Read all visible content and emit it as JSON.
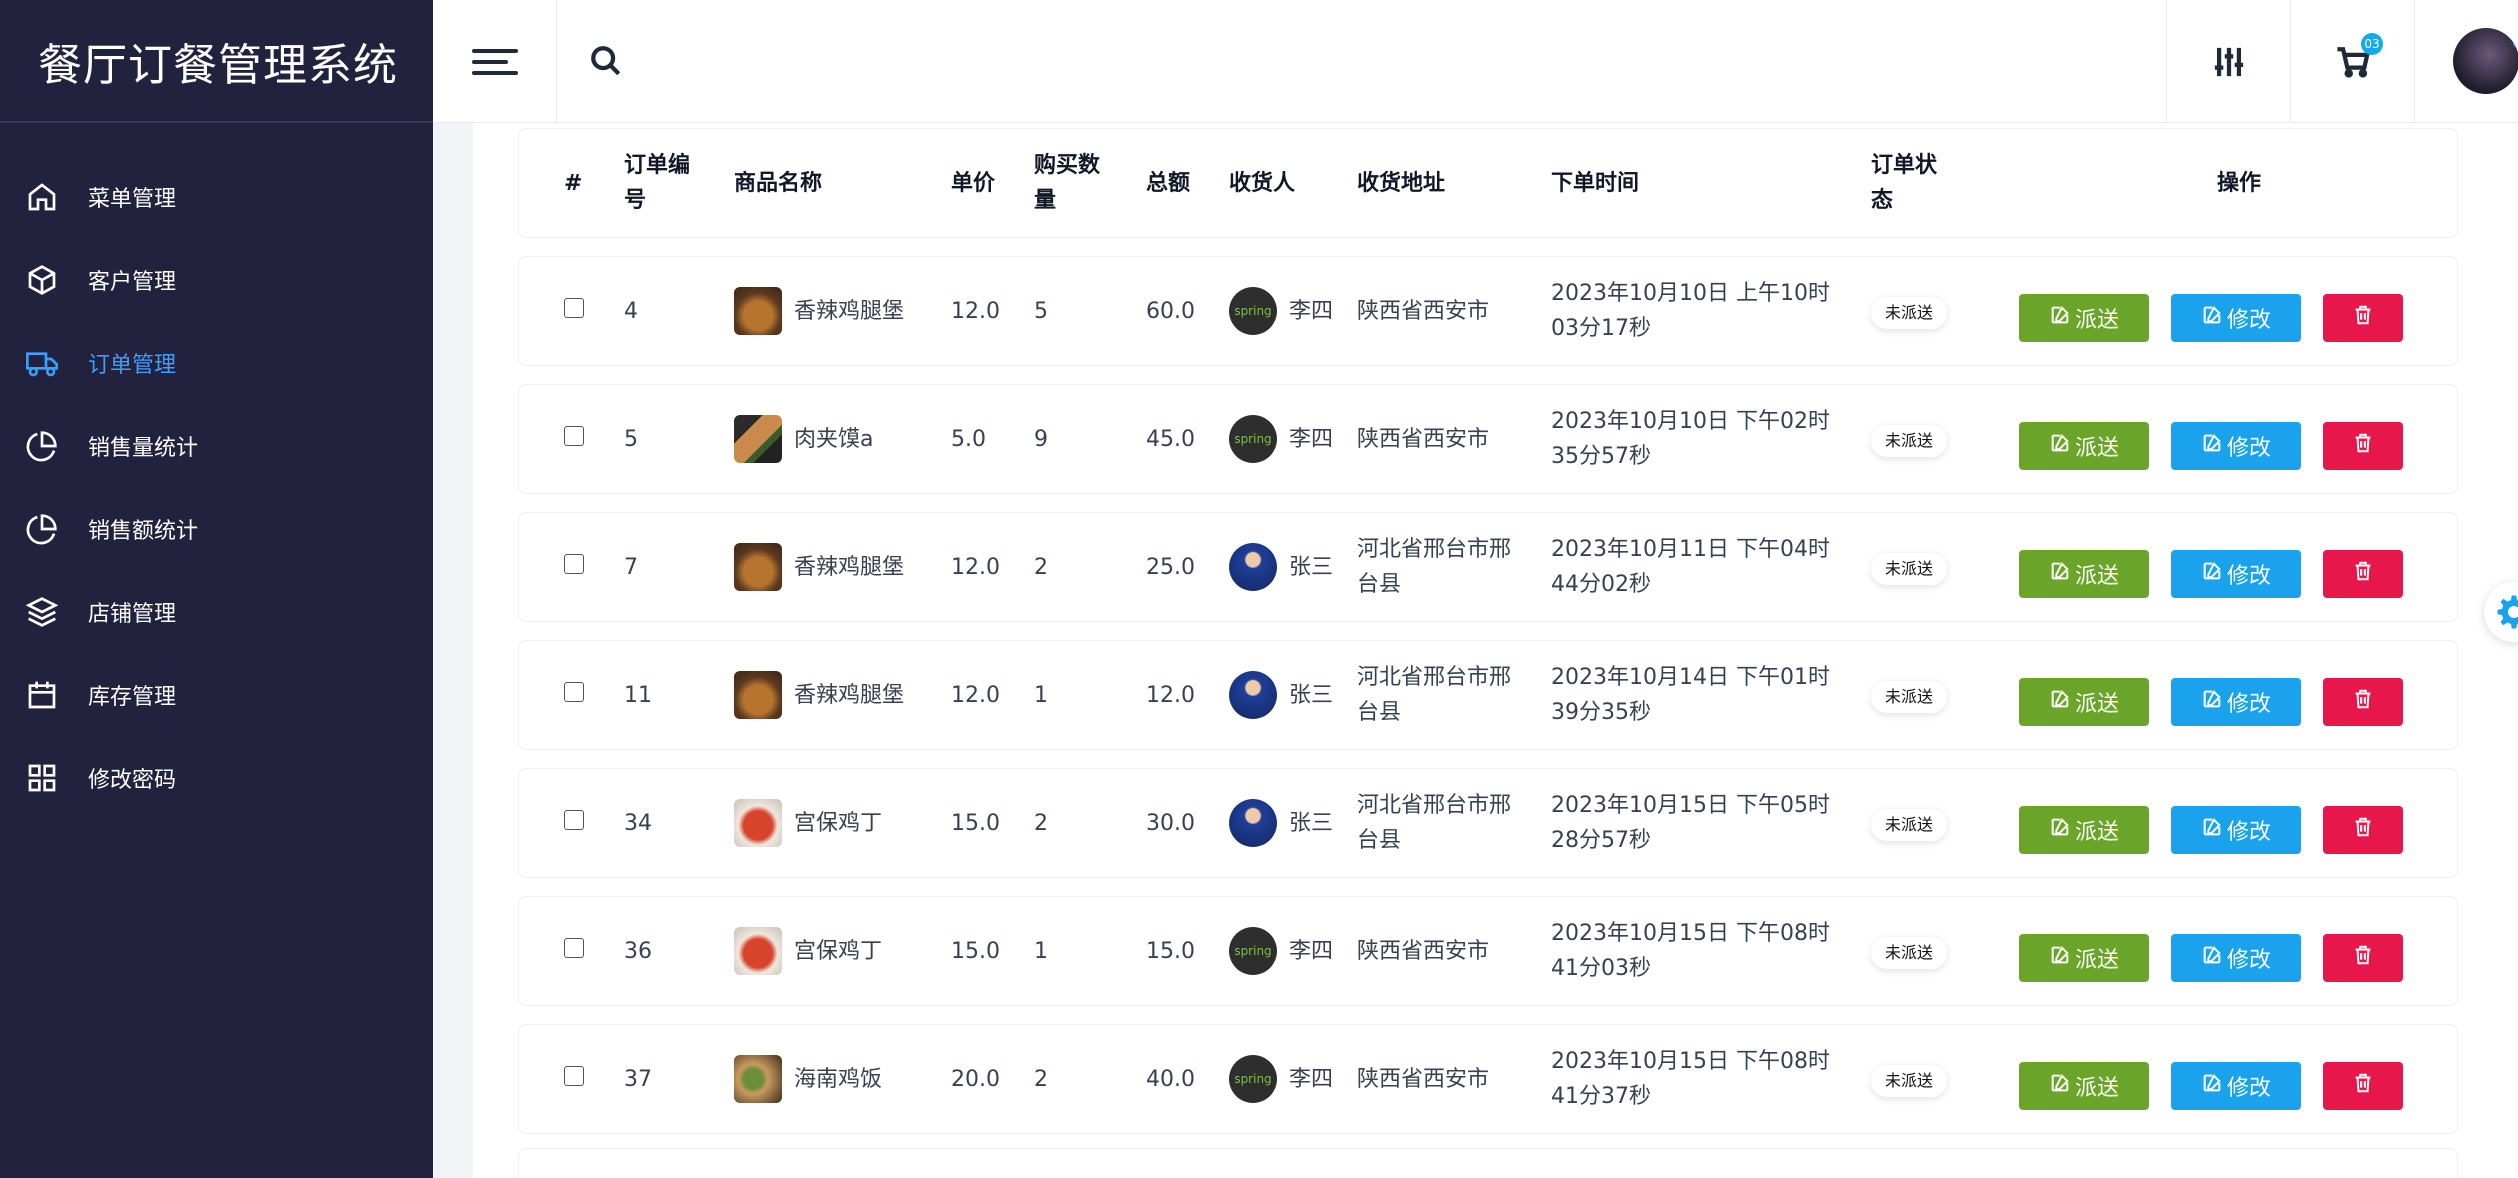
{
  "app": {
    "title": "餐厅订餐管理系统"
  },
  "sidebar": {
    "items": [
      {
        "label": "菜单管理",
        "icon": "home-icon"
      },
      {
        "label": "客户管理",
        "icon": "box-icon"
      },
      {
        "label": "订单管理",
        "icon": "truck-icon",
        "active": true
      },
      {
        "label": "销售量统计",
        "icon": "pie-chart-icon"
      },
      {
        "label": "销售额统计",
        "icon": "pie-chart-icon"
      },
      {
        "label": "店铺管理",
        "icon": "layers-icon"
      },
      {
        "label": "库存管理",
        "icon": "calendar-icon"
      },
      {
        "label": "修改密码",
        "icon": "grid-icon"
      }
    ]
  },
  "header": {
    "cart_badge": "03"
  },
  "table": {
    "headers": [
      "#",
      "订单编号",
      "商品名称",
      "单价",
      "购买数量",
      "总额",
      "收货人",
      "收货地址",
      "下单时间",
      "订单状态",
      "操作"
    ],
    "rows": [
      {
        "id": "4",
        "product": "香辣鸡腿堡",
        "thumb": "burger",
        "price": "12.0",
        "qty": "5",
        "total": "60.0",
        "receiver": "李四",
        "avatar": "spring",
        "address": "陕西省西安市",
        "time": "2023年10月10日 上午10时03分17秒",
        "status": "未派送"
      },
      {
        "id": "5",
        "product": "肉夹馍a",
        "thumb": "sandwich",
        "price": "5.0",
        "qty": "9",
        "total": "45.0",
        "receiver": "李四",
        "avatar": "spring",
        "address": "陕西省西安市",
        "time": "2023年10月10日 下午02时35分57秒",
        "status": "未派送"
      },
      {
        "id": "7",
        "product": "香辣鸡腿堡",
        "thumb": "burger",
        "price": "12.0",
        "qty": "2",
        "total": "25.0",
        "receiver": "张三",
        "avatar": "person",
        "address": "河北省邢台市邢台县",
        "time": "2023年10月11日 下午04时44分02秒",
        "status": "未派送"
      },
      {
        "id": "11",
        "product": "香辣鸡腿堡",
        "thumb": "burger",
        "price": "12.0",
        "qty": "1",
        "total": "12.0",
        "receiver": "张三",
        "avatar": "person",
        "address": "河北省邢台市邢台县",
        "time": "2023年10月14日 下午01时39分35秒",
        "status": "未派送"
      },
      {
        "id": "34",
        "product": "宫保鸡丁",
        "thumb": "chicken",
        "price": "15.0",
        "qty": "2",
        "total": "30.0",
        "receiver": "张三",
        "avatar": "person",
        "address": "河北省邢台市邢台县",
        "time": "2023年10月15日 下午05时28分57秒",
        "status": "未派送"
      },
      {
        "id": "36",
        "product": "宫保鸡丁",
        "thumb": "chicken",
        "price": "15.0",
        "qty": "1",
        "total": "15.0",
        "receiver": "李四",
        "avatar": "spring",
        "address": "陕西省西安市",
        "time": "2023年10月15日 下午08时41分03秒",
        "status": "未派送"
      },
      {
        "id": "37",
        "product": "海南鸡饭",
        "thumb": "rice",
        "price": "20.0",
        "qty": "2",
        "total": "40.0",
        "receiver": "李四",
        "avatar": "spring",
        "address": "陕西省西安市",
        "time": "2023年10月15日 下午08时41分37秒",
        "status": "未派送"
      }
    ]
  },
  "actions": {
    "send": "派送",
    "edit": "修改"
  },
  "avatar_label": "spring",
  "colors": {
    "sidebar_bg": "#22223f",
    "active": "#3aa0ff",
    "send": "#6aa52a",
    "edit": "#1aa3ec",
    "delete": "#e8174b"
  }
}
